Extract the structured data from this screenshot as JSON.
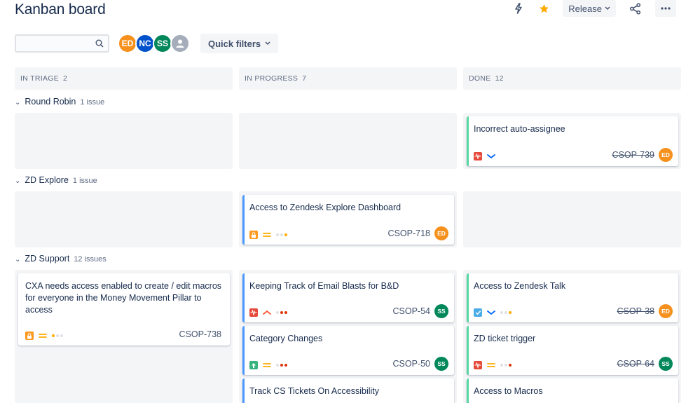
{
  "board": {
    "title": "Kanban board"
  },
  "actions": {
    "release_label": "Release"
  },
  "search": {
    "placeholder": "",
    "value": ""
  },
  "avatars": [
    {
      "initials": "ED",
      "color": "#f6911e"
    },
    {
      "initials": "NC",
      "color": "#0052cc"
    },
    {
      "initials": "SS",
      "color": "#00875a"
    },
    {
      "initials": "",
      "color": "#a5adba"
    }
  ],
  "quick_filters": {
    "label": "Quick filters"
  },
  "columns": [
    {
      "name": "IN TRIAGE",
      "count": "2"
    },
    {
      "name": "IN PROGRESS",
      "count": "7"
    },
    {
      "name": "DONE",
      "count": "12"
    }
  ],
  "swimlanes": [
    {
      "name": "Round Robin",
      "count_label": "1 issue"
    },
    {
      "name": "ZD Explore",
      "count_label": "1 issue"
    },
    {
      "name": "ZD Support",
      "count_label": "12 issues"
    }
  ],
  "cards": {
    "rr_done": {
      "title": "Incorrect auto-assignee",
      "key": "CSOP-739",
      "assignee": "ED",
      "status_color": "#57d9a3"
    },
    "zde_prog": {
      "title": "Access to Zendesk Explore Dashboard",
      "key": "CSOP-718",
      "assignee": "ED",
      "status_color": "#4c9aff"
    },
    "zds_triage": {
      "title": "CXA needs access enabled to create / edit macros for everyone in the Money Movement Pillar to access",
      "key": "CSOP-738"
    },
    "zds_prog_1": {
      "title": "Keeping Track of Email Blasts for B&D",
      "key": "CSOP-54",
      "assignee": "SS",
      "status_color": "#4c9aff"
    },
    "zds_prog_2": {
      "title": "Category Changes",
      "key": "CSOP-50",
      "assignee": "SS",
      "status_color": "#4c9aff"
    },
    "zds_prog_3": {
      "title": "Track CS Tickets On Accessibility",
      "status_color": "#4c9aff"
    },
    "zds_done_1": {
      "title": "Access to Zendesk Talk",
      "key": "CSOP-38",
      "assignee": "ED",
      "status_color": "#57d9a3"
    },
    "zds_done_2": {
      "title": "ZD ticket trigger",
      "key": "CSOP-64",
      "assignee": "SS",
      "status_color": "#57d9a3"
    },
    "zds_done_3": {
      "title": "Access to Macros",
      "status_color": "#57d9a3"
    }
  },
  "colors": {
    "ed": "#f6911e",
    "ss": "#00875a",
    "nc": "#0052cc",
    "star": "#ffab00",
    "bug": "#e5493a",
    "task": "#4bade8",
    "improvement": "#36b37e",
    "access": "#ff991f"
  }
}
